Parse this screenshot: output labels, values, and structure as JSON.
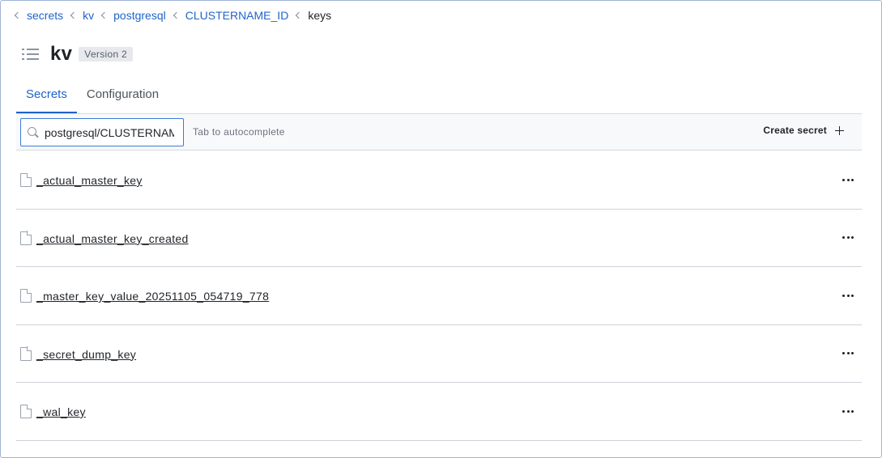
{
  "breadcrumb": {
    "items": [
      {
        "label": "secrets"
      },
      {
        "label": "kv"
      },
      {
        "label": "postgresql"
      },
      {
        "label": "CLUSTERNAME_ID"
      },
      {
        "label": "keys"
      }
    ]
  },
  "header": {
    "title": "kv",
    "version_badge": "Version 2",
    "menu_icon": "list-icon"
  },
  "tabs": [
    {
      "label": "Secrets",
      "active": true
    },
    {
      "label": "Configuration",
      "active": false
    }
  ],
  "toolbar": {
    "search_value": "postgresql/CLUSTERNAME_ID/keys/",
    "search_icon": "search-icon",
    "hint": "Tab to autocomplete",
    "create_label": "Create secret",
    "create_icon": "plus-icon"
  },
  "secrets": [
    {
      "name": "_actual_master_key"
    },
    {
      "name": "_actual_master_key_created"
    },
    {
      "name": "_master_key_value_20251105_054719_778"
    },
    {
      "name": "_secret_dump_key"
    },
    {
      "name": "_wal_key"
    }
  ],
  "colors": {
    "accent": "#1f64c8",
    "border": "#d6dbe1",
    "focus": "#3a7bd5"
  }
}
